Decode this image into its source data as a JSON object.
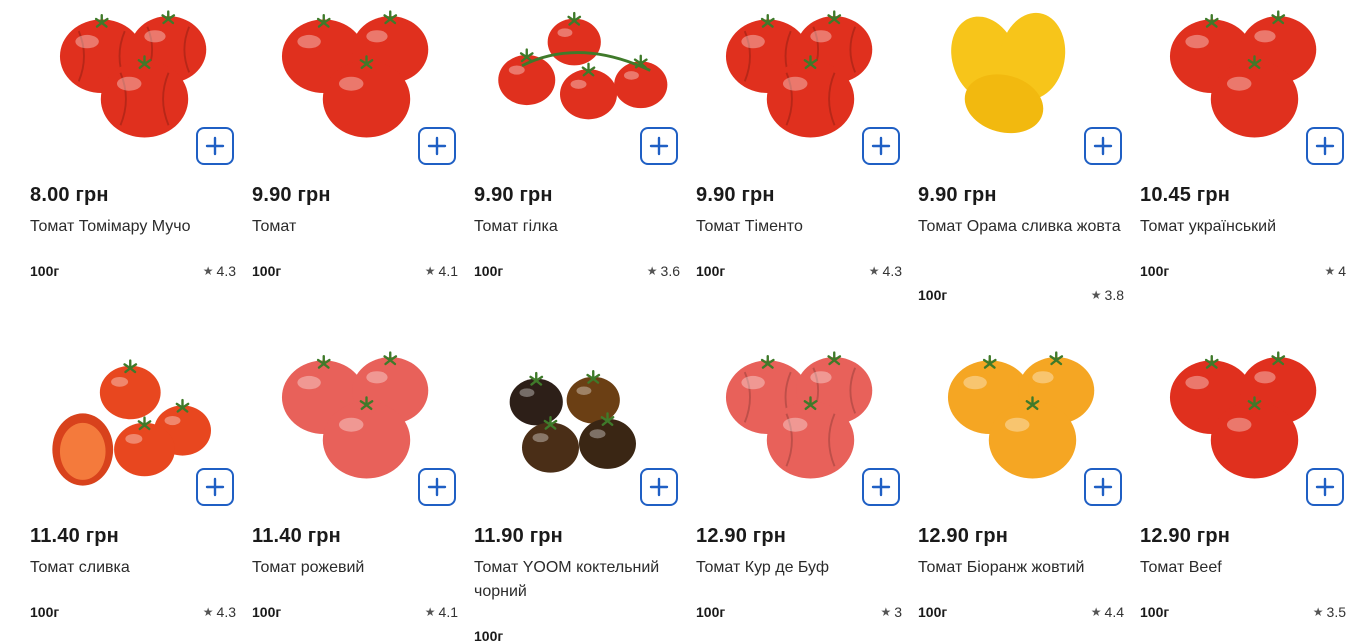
{
  "products": [
    {
      "price": "8.00 грн",
      "name": "Томат Томімару Мучо",
      "weight": "100г",
      "rating": "4.3",
      "image": "tomato-red-ribbed"
    },
    {
      "price": "9.90 грн",
      "name": "Томат",
      "weight": "100г",
      "rating": "4.1",
      "image": "tomato-red"
    },
    {
      "price": "9.90 грн",
      "name": "Томат гілка",
      "weight": "100г",
      "rating": "3.6",
      "image": "tomato-vine"
    },
    {
      "price": "9.90 грн",
      "name": "Томат Тіменто",
      "weight": "100г",
      "rating": "4.3",
      "image": "tomato-red-ribbed"
    },
    {
      "price": "9.90 грн",
      "name": "Томат Орама сливка жовта",
      "weight": "100г",
      "rating": "3.8",
      "image": "tomato-yellow-plum"
    },
    {
      "price": "10.45 грн",
      "name": "Томат український",
      "weight": "100г",
      "rating": "4",
      "image": "tomato-red"
    },
    {
      "price": "11.40 грн",
      "name": "Томат сливка",
      "weight": "100г",
      "rating": "4.3",
      "image": "tomato-plum"
    },
    {
      "price": "11.40 грн",
      "name": "Томат рожевий",
      "weight": "100г",
      "rating": "4.1",
      "image": "tomato-pink"
    },
    {
      "price": "11.90 грн",
      "name": "Томат YOOM коктельний чорний",
      "weight": "100г",
      "rating": "",
      "image": "tomato-black-cocktail"
    },
    {
      "price": "12.90 грн",
      "name": "Томат Кур де Буф",
      "weight": "100г",
      "rating": "3",
      "image": "tomato-pink-ribbed"
    },
    {
      "price": "12.90 грн",
      "name": "Томат Біоранж жовтий",
      "weight": "100г",
      "rating": "4.4",
      "image": "tomato-yellow-round"
    },
    {
      "price": "12.90 грн",
      "name": "Томат Beef",
      "weight": "100г",
      "rating": "3.5",
      "image": "tomato-red"
    }
  ],
  "colors": {
    "accent": "#1f5fc4",
    "red": "#e0301e",
    "pink": "#e8615a",
    "yellow": "#f7c51a",
    "orange": "#f5a623",
    "dark": "#3a2a1e",
    "stem": "#3f7a2a"
  },
  "icons": {
    "add": "plus-icon",
    "rating": "star-icon"
  }
}
